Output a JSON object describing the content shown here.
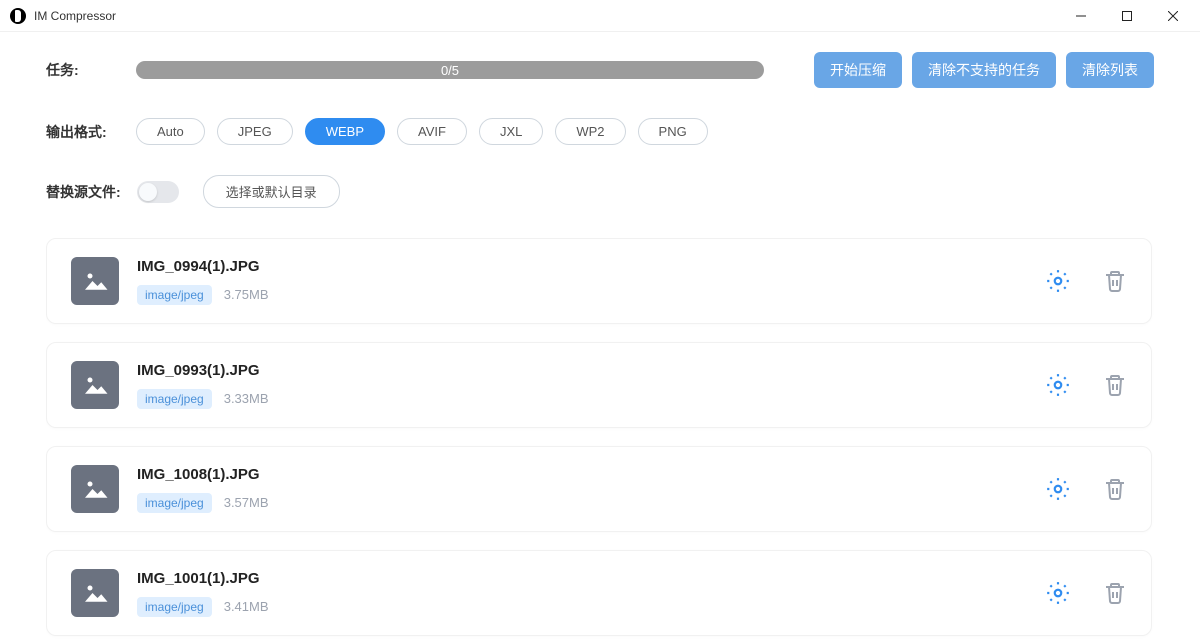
{
  "window": {
    "title": "IM Compressor"
  },
  "tasks": {
    "label": "任务:",
    "progress_text": "0/5"
  },
  "actions": {
    "start": "开始压缩",
    "clear_unsupported": "清除不支持的任务",
    "clear_list": "清除列表"
  },
  "output_format": {
    "label": "输出格式:",
    "options": [
      "Auto",
      "JPEG",
      "WEBP",
      "AVIF",
      "JXL",
      "WP2",
      "PNG"
    ],
    "selected": "WEBP"
  },
  "replace_source": {
    "label": "替换源文件:",
    "enabled": false,
    "choose_dir": "选择或默认目录"
  },
  "files": [
    {
      "name": "IMG_0994(1).JPG",
      "mime": "image/jpeg",
      "size": "3.75MB"
    },
    {
      "name": "IMG_0993(1).JPG",
      "mime": "image/jpeg",
      "size": "3.33MB"
    },
    {
      "name": "IMG_1008(1).JPG",
      "mime": "image/jpeg",
      "size": "3.57MB"
    },
    {
      "name": "IMG_1001(1).JPG",
      "mime": "image/jpeg",
      "size": "3.41MB"
    }
  ]
}
